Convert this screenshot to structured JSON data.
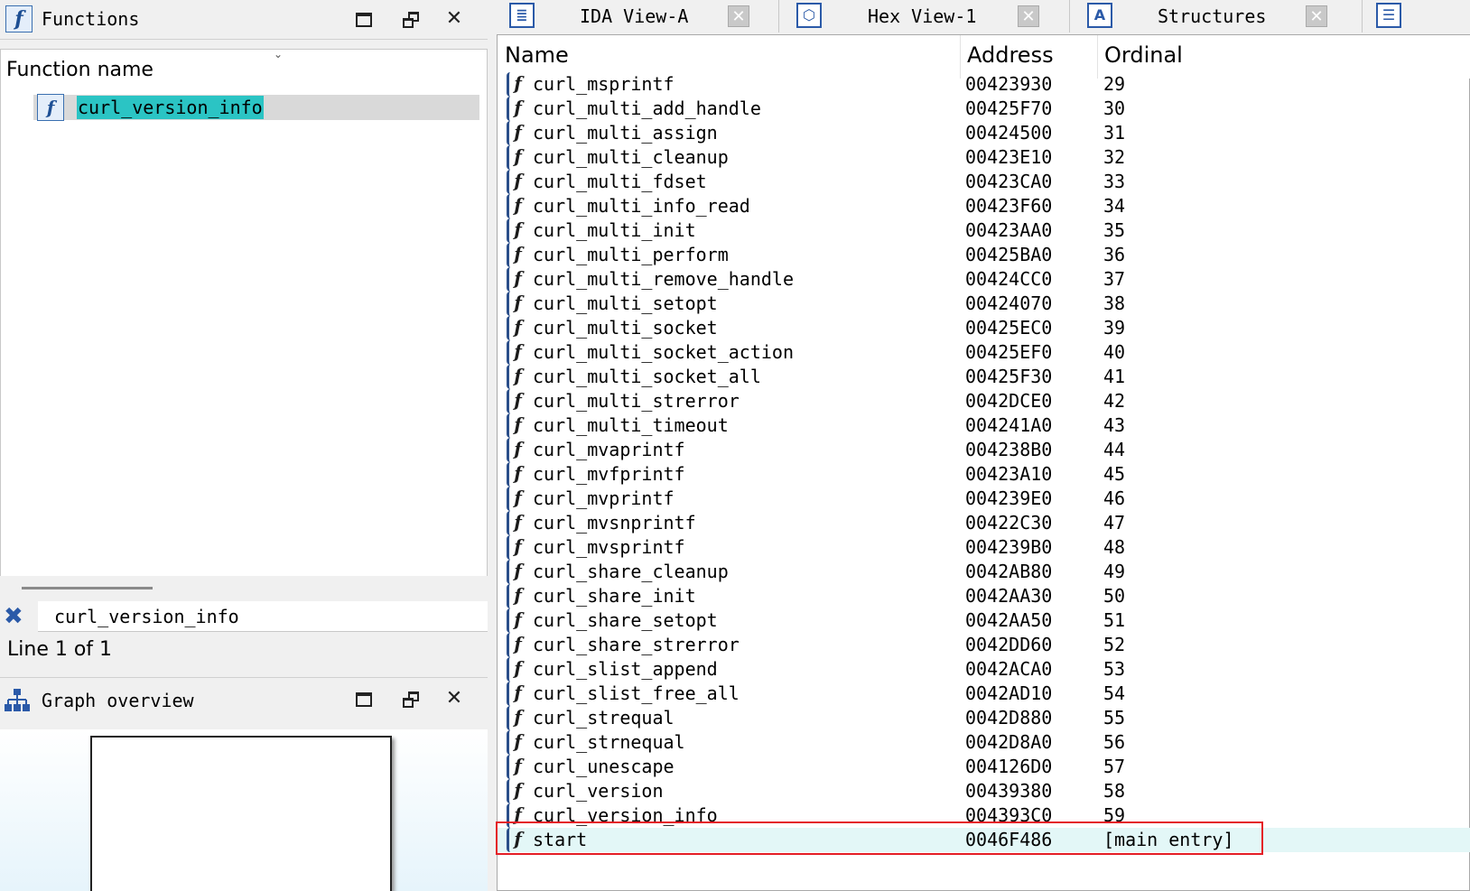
{
  "functions_pane": {
    "title": "Functions",
    "icon": "f-function-icon",
    "column_header": "Function name",
    "rows": [
      {
        "name": "curl_version_info"
      }
    ],
    "search_value": "curl_version_info",
    "status": "Line 1 of 1"
  },
  "graph_overview": {
    "title": "Graph overview"
  },
  "tabs": [
    {
      "label": "IDA View-A",
      "icon": "disassembly-icon"
    },
    {
      "label": "Hex View-1",
      "icon": "hex-icon"
    },
    {
      "label": "Structures",
      "icon": "structures-icon"
    }
  ],
  "exports": {
    "columns": [
      "Name",
      "Address",
      "Ordinal"
    ],
    "rows": [
      {
        "name": "curl_msprintf",
        "address": "00423930",
        "ordinal": "29"
      },
      {
        "name": "curl_multi_add_handle",
        "address": "00425F70",
        "ordinal": "30"
      },
      {
        "name": "curl_multi_assign",
        "address": "00424500",
        "ordinal": "31"
      },
      {
        "name": "curl_multi_cleanup",
        "address": "00423E10",
        "ordinal": "32"
      },
      {
        "name": "curl_multi_fdset",
        "address": "00423CA0",
        "ordinal": "33"
      },
      {
        "name": "curl_multi_info_read",
        "address": "00423F60",
        "ordinal": "34"
      },
      {
        "name": "curl_multi_init",
        "address": "00423AA0",
        "ordinal": "35"
      },
      {
        "name": "curl_multi_perform",
        "address": "00425BA0",
        "ordinal": "36"
      },
      {
        "name": "curl_multi_remove_handle",
        "address": "00424CC0",
        "ordinal": "37"
      },
      {
        "name": "curl_multi_setopt",
        "address": "00424070",
        "ordinal": "38"
      },
      {
        "name": "curl_multi_socket",
        "address": "00425EC0",
        "ordinal": "39"
      },
      {
        "name": "curl_multi_socket_action",
        "address": "00425EF0",
        "ordinal": "40"
      },
      {
        "name": "curl_multi_socket_all",
        "address": "00425F30",
        "ordinal": "41"
      },
      {
        "name": "curl_multi_strerror",
        "address": "0042DCE0",
        "ordinal": "42"
      },
      {
        "name": "curl_multi_timeout",
        "address": "004241A0",
        "ordinal": "43"
      },
      {
        "name": "curl_mvaprintf",
        "address": "004238B0",
        "ordinal": "44"
      },
      {
        "name": "curl_mvfprintf",
        "address": "00423A10",
        "ordinal": "45"
      },
      {
        "name": "curl_mvprintf",
        "address": "004239E0",
        "ordinal": "46"
      },
      {
        "name": "curl_mvsnprintf",
        "address": "00422C30",
        "ordinal": "47"
      },
      {
        "name": "curl_mvsprintf",
        "address": "004239B0",
        "ordinal": "48"
      },
      {
        "name": "curl_share_cleanup",
        "address": "0042AB80",
        "ordinal": "49"
      },
      {
        "name": "curl_share_init",
        "address": "0042AA30",
        "ordinal": "50"
      },
      {
        "name": "curl_share_setopt",
        "address": "0042AA50",
        "ordinal": "51"
      },
      {
        "name": "curl_share_strerror",
        "address": "0042DD60",
        "ordinal": "52"
      },
      {
        "name": "curl_slist_append",
        "address": "0042ACA0",
        "ordinal": "53"
      },
      {
        "name": "curl_slist_free_all",
        "address": "0042AD10",
        "ordinal": "54"
      },
      {
        "name": "curl_strequal",
        "address": "0042D880",
        "ordinal": "55"
      },
      {
        "name": "curl_strnequal",
        "address": "0042D8A0",
        "ordinal": "56"
      },
      {
        "name": "curl_unescape",
        "address": "004126D0",
        "ordinal": "57"
      },
      {
        "name": "curl_version",
        "address": "00439380",
        "ordinal": "58"
      },
      {
        "name": "curl_version_info",
        "address": "004393C0",
        "ordinal": "59"
      },
      {
        "name": "start",
        "address": "0046F486",
        "ordinal": "[main entry]"
      }
    ],
    "highlighted_row": "curl_version_info",
    "selected_row": "start"
  },
  "colors": {
    "selection_teal": "#2bc4c4",
    "highlight_red": "#e41e26",
    "icon_blue": "#2b5aa8",
    "selected_row_bg": "#e3f7f7"
  }
}
